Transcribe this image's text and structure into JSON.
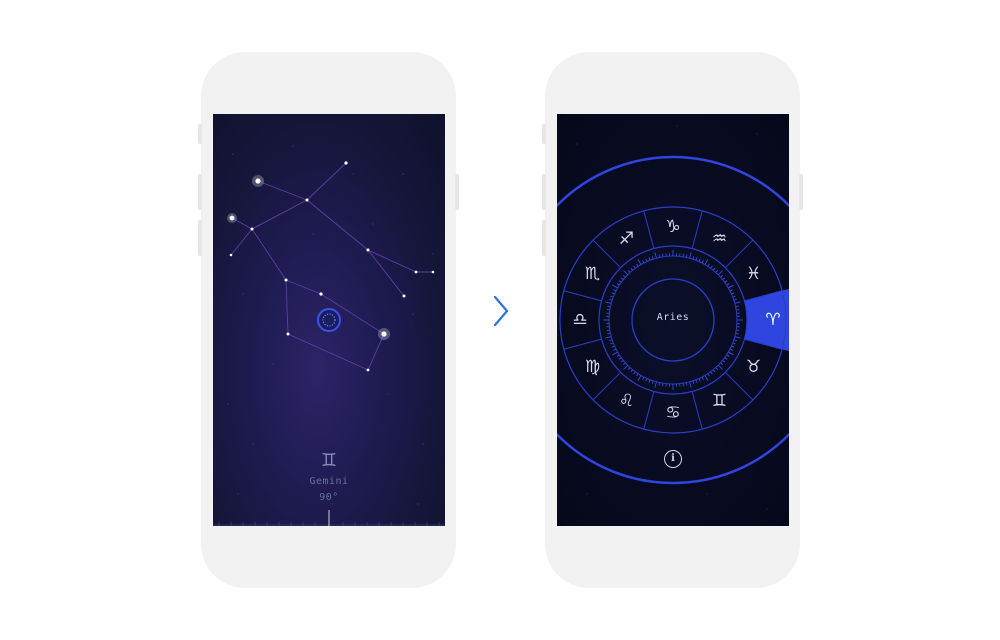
{
  "left_screen": {
    "sign_symbol": "♊",
    "sign_name": "Gemini",
    "degree": "90°"
  },
  "right_screen": {
    "center_label": "Aries",
    "selected_sign": "aries",
    "accent_color": "#2f45e0",
    "info_glyph": "i",
    "zodiac_signs": [
      {
        "id": "scorpio",
        "symbol": "♏"
      },
      {
        "id": "sagittarius",
        "symbol": "♐"
      },
      {
        "id": "capricorn",
        "symbol": "♑"
      },
      {
        "id": "aquarius",
        "symbol": "♒"
      },
      {
        "id": "pisces",
        "symbol": "♓"
      },
      {
        "id": "aries",
        "symbol": "♈"
      },
      {
        "id": "taurus",
        "symbol": "♉"
      },
      {
        "id": "gemini",
        "symbol": "♊"
      },
      {
        "id": "cancer",
        "symbol": "♋"
      },
      {
        "id": "leo",
        "symbol": "♌"
      },
      {
        "id": "virgo",
        "symbol": "♍"
      },
      {
        "id": "libra",
        "symbol": "♎"
      }
    ]
  },
  "transition": {
    "icon": "chevron-right-icon",
    "color": "#2f6fe8"
  }
}
